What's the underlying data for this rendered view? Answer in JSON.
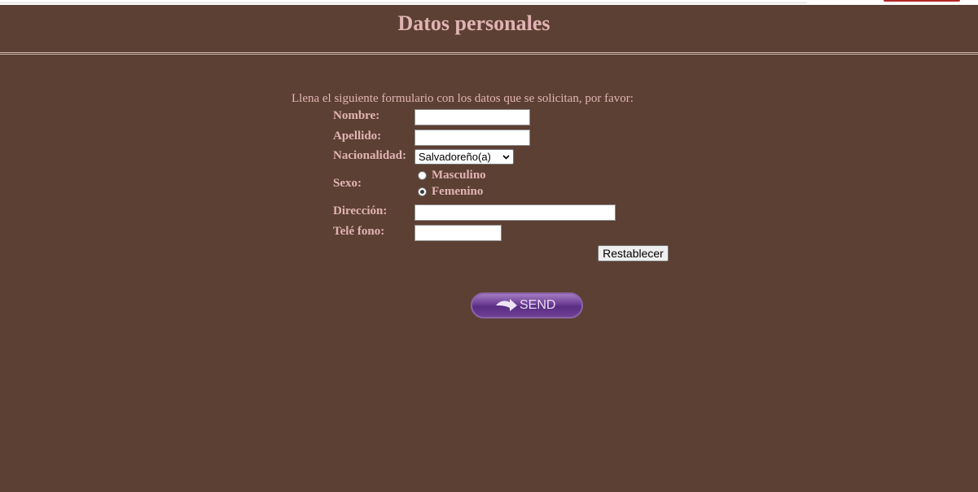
{
  "header": {
    "title": "Datos personales"
  },
  "form": {
    "intro": "Llena el siguiente formulario con los datos que se solicitan, por favor:",
    "nombre": {
      "label": "Nombre:",
      "value": ""
    },
    "apellido": {
      "label": "Apellido:",
      "value": ""
    },
    "nacionalidad": {
      "label": "Nacionalidad:",
      "selected": "Salvadoreño(a)"
    },
    "sexo": {
      "label": "Sexo:",
      "options": [
        {
          "label": "Masculino",
          "checked": false
        },
        {
          "label": "Femenino",
          "checked": true
        }
      ]
    },
    "direccion": {
      "label": "Dirección:",
      "value": ""
    },
    "telefono": {
      "label": "Telé fono:",
      "value": ""
    },
    "reset_label": "Restablecer",
    "send_label": "SEND"
  },
  "colors": {
    "background": "#5c4033",
    "text": "#e1b4b4",
    "send_button": "#6c3c93"
  }
}
